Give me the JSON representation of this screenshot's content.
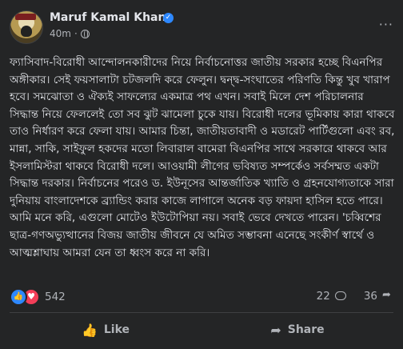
{
  "author": {
    "name": "Maruf Kamal Khan",
    "time": "40m",
    "visibility_icon": "globe-icon",
    "verified_icon": "verified-badge-icon"
  },
  "post": {
    "text": "ফ্যাসিবাদ-বিরোধী আন্দোলনকারীদের নিয়ে নির্বাচনোত্তর জাতীয় সরকার হচ্ছে বিএনপির অঙ্গীকার। সেই ফয়সালাটা চটজলদি করে ফেলুন। দ্বন্দ্ব-সংঘাতের পরিণতি কিন্তু খুব খারাপ হবে। সমঝোতা ও ঐক্যই সাফল্যের একমাত্র পথ এখন। সবাই মিলে দেশ পরিচালনার সিদ্ধান্ত নিয়ে ফেললেই তো সব ঝুট ঝামেলা চুকে যায়। বিরোধী দলের ভূমিকায় কারা থাকবে তাও নির্ধারণ করে ফেলা যায়। আমার চিন্তা, জাতীয়তাবাদী ও মডারেট পার্টিগুলো এবং রব, মান্না, সাকি, সাইফুল হকদের মতো লিবারাল বামেরা বিএনপির সাথে সরকারে থাকবে আর ইসলামিস্টরা থাকবে বিরোধী দলে। আওয়ামী লীগের ভবিষ্যত সম্পর্কেও সর্বসম্মত একটা সিদ্ধান্ত দরকার। নির্বাচনের পরেও ড. ইউনূসের আন্তর্জাতিক খ্যাতি ও গ্রহনযোগ্যতাকে সারা দুনিয়ায় বাংলাদেশকে ব্র্যান্ডিং করার কাজে লাগালে অনেক বড় ফায়দা হাসিল হতে পারে। আমি মনে করি, এগুলো মোটেও ইউটোপিয়া নয়। সবাই ভেবে দেখতে পারেন। 'চব্বিশের ছাত্র-গণঅভ্যুত্থানের বিজয় জাতীয় জীবনে যে অমিত সম্ভাবনা এনেছে সংকীর্ণ স্বার্থে ও আত্মশ্লাঘায় আমরা যেন তা ধ্বংস করে না করি।"
  },
  "stats": {
    "reaction_count": "542",
    "reaction_icons": [
      "like-reaction-icon",
      "love-reaction-icon"
    ],
    "comment_count": "22",
    "share_count": "36"
  },
  "actions": {
    "like_label": "Like",
    "share_label": "Share"
  },
  "colors": {
    "background": "#242526",
    "text_primary": "#e4e6eb",
    "text_secondary": "#b0b3b8",
    "like_blue": "#2d88ff",
    "love_red": "#f33e58"
  }
}
